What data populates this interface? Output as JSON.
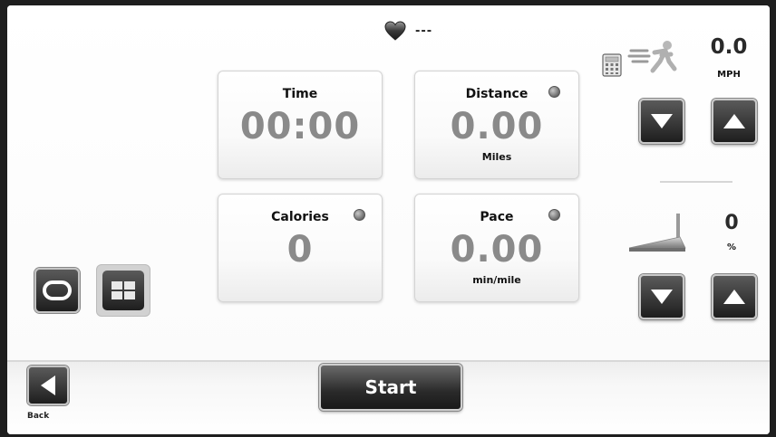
{
  "heart_rate": {
    "value": "---",
    "icon": "heart-icon"
  },
  "metrics": {
    "time": {
      "label": "Time",
      "value": "00:00"
    },
    "distance": {
      "label": "Distance",
      "value": "0.00",
      "unit": "Miles"
    },
    "calories": {
      "label": "Calories",
      "value": "0"
    },
    "pace": {
      "label": "Pace",
      "value": "0.00",
      "unit": "min/mile"
    }
  },
  "speed": {
    "value": "0.0",
    "unit": "MPH"
  },
  "incline": {
    "value": "0",
    "unit": "%"
  },
  "footer": {
    "back_label": "Back",
    "start_label": "Start"
  },
  "colors": {
    "accent_dark": "#1e1e1e",
    "value_gray": "#8a8a8a",
    "background": "#ffffff"
  }
}
